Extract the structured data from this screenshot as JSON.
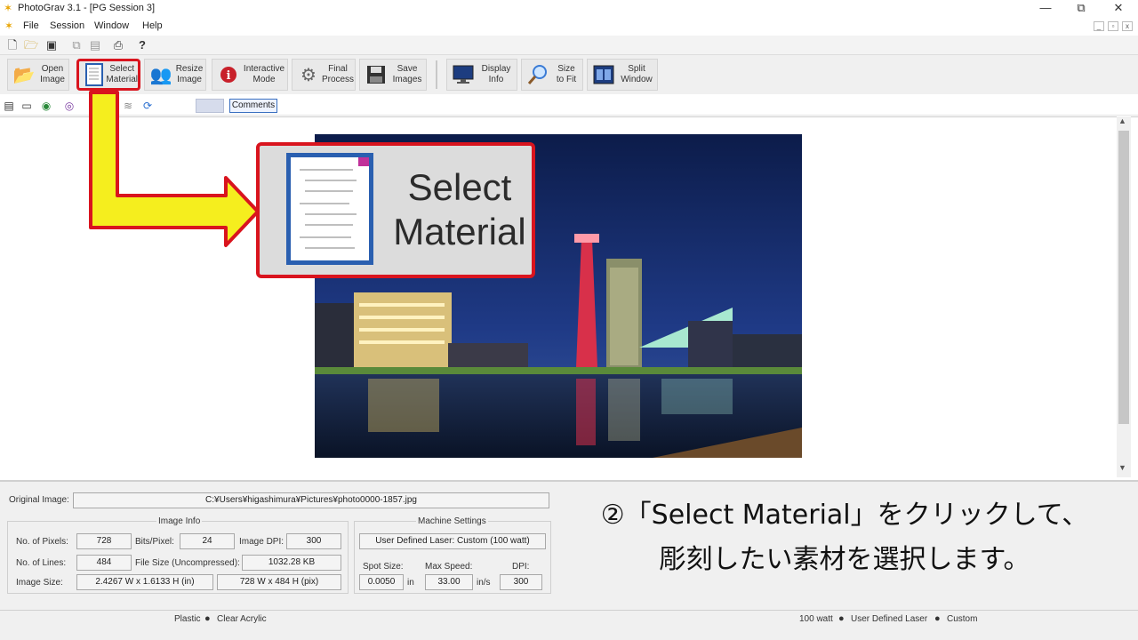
{
  "window": {
    "title": "PhotoGrav 3.1 - [PG Session 3]",
    "minimize": "—",
    "restore": "⧉",
    "close": "✕",
    "mdi_min": "_",
    "mdi_restore": "▫",
    "mdi_close": "x"
  },
  "menu": [
    "File",
    "Session",
    "Window",
    "Help"
  ],
  "toolbar": {
    "buttons": [
      {
        "label": "Open\nImage",
        "icon": "folder-open-icon"
      },
      {
        "label": "Select\nMaterial",
        "icon": "material-list-icon"
      },
      {
        "label": "Resize\nImage",
        "icon": "people-resize-icon"
      },
      {
        "label": "Interactive\nMode",
        "icon": "info-icon"
      },
      {
        "label": "Final\nProcess",
        "icon": "gear-icon"
      },
      {
        "label": "Save\nImages",
        "icon": "floppy-icon"
      },
      {
        "label": "Display\nInfo",
        "icon": "monitor-icon"
      },
      {
        "label": "Size\nto Fit",
        "icon": "magnifier-icon"
      },
      {
        "label": "Split\nWindow",
        "icon": "split-window-icon"
      }
    ]
  },
  "secondary_toolbar": {
    "comments_label": "Comments"
  },
  "callout": {
    "line1": "Select",
    "line2": "Material"
  },
  "info_panel": {
    "original_image_label": "Original Image:",
    "original_image_path": "C:¥Users¥higashimura¥Pictures¥photo0000-1857.jpg",
    "image_info_title": "Image Info",
    "pixels_label": "No. of Pixels:",
    "pixels": "728",
    "bits_label": "Bits/Pixel:",
    "bits": "24",
    "dpi_label": "Image DPI:",
    "dpi": "300",
    "lines_label": "No. of Lines:",
    "lines": "484",
    "filesize_label": "File Size (Uncompressed):",
    "filesize": "1032.28 KB",
    "size_label": "Image Size:",
    "size_in": "2.4267 W x 1.6133 H (in)",
    "size_px": "728 W x 484 H (pix)",
    "machine_title": "Machine Settings",
    "laser": "User Defined Laser: Custom (100 watt)",
    "spot_label": "Spot Size:",
    "spot": "0.0050",
    "spot_unit": "in",
    "speed_label": "Max Speed:",
    "speed": "33.00",
    "speed_unit": "in/s",
    "mdpi_label": "DPI:",
    "mdpi": "300"
  },
  "status": {
    "left_a": "Plastic",
    "left_b": "Clear Acrylic",
    "right_a": "100 watt",
    "right_b": "User Defined Laser",
    "right_c": "Custom"
  },
  "annotation": {
    "line1": "②「Select Material」をクリックして、",
    "line2": "彫刻したい素材を選択します。"
  },
  "colors": {
    "highlight_red": "#d9141e",
    "arrow_yellow": "#f5ee1e"
  }
}
